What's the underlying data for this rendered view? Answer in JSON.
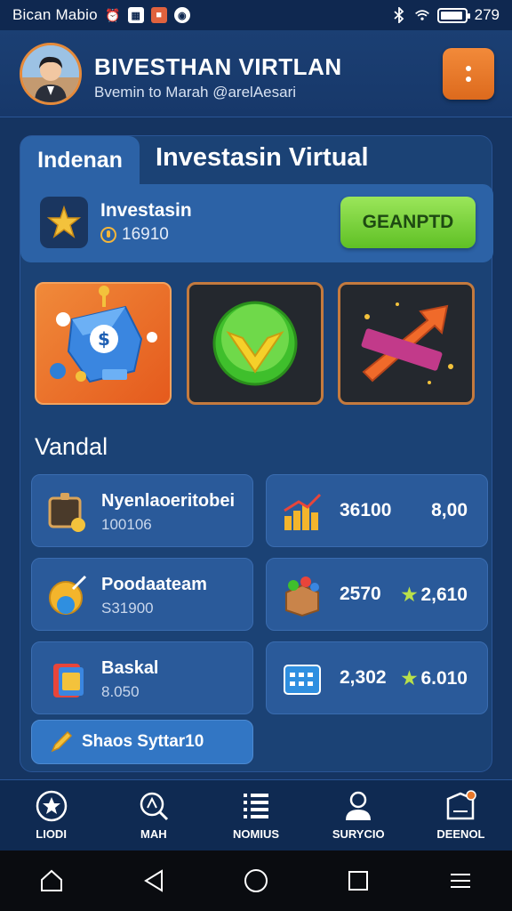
{
  "status_bar": {
    "carrier": "Bican Mabio",
    "time": "279",
    "battery_fraction": 0.95,
    "icons": [
      "alarm-icon",
      "image-icon",
      "app-icon",
      "compass-icon",
      "bluetooth-icon",
      "wifi-icon",
      "battery-icon"
    ]
  },
  "header": {
    "title": "BIVESTHAN VIRTLAN",
    "subtitle": "Bvemin to Marah @arelAesari",
    "menu_icon": "more-vertical-icon"
  },
  "tabs": {
    "active": "Indenan",
    "title": "Investasin Virtual"
  },
  "investment": {
    "label": "Investasin",
    "value": "16910",
    "button": "GEANPTD"
  },
  "section": {
    "title": "Vandal"
  },
  "stats_left": [
    {
      "name": "Nyenlaoeritobei",
      "value": "100106",
      "icon": "tablet-icon"
    },
    {
      "name": "Poodaateam",
      "value": "S31900",
      "icon": "globe-icon"
    },
    {
      "name": "Baskal",
      "value": "8.050",
      "icon": "cards-icon"
    }
  ],
  "stats_right": [
    {
      "a": "36100",
      "b": "8,00",
      "icon": "bar-chart-icon",
      "star": false
    },
    {
      "a": "2570",
      "b": "2,610",
      "icon": "box-icon",
      "star": true
    },
    {
      "a": "2,302",
      "b": "6.010",
      "icon": "calendar-icon",
      "star": true
    }
  ],
  "status_button": {
    "label": "Shaos Syttar10"
  },
  "bottom_nav": [
    {
      "label": "LIODI",
      "icon": "star-icon"
    },
    {
      "label": "MAH",
      "icon": "search-icon"
    },
    {
      "label": "NOMIUS",
      "icon": "list-icon"
    },
    {
      "label": "SURYCIO",
      "icon": "user-icon"
    },
    {
      "label": "DEENOL",
      "icon": "document-icon"
    }
  ],
  "colors": {
    "background": "#153461",
    "accent_orange": "#e8782a",
    "accent_green": "#7ed644"
  }
}
